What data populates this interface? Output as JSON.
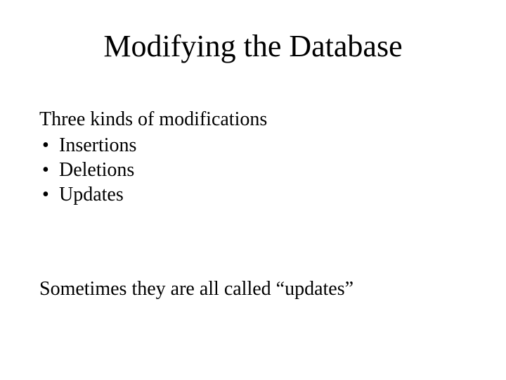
{
  "title": "Modifying the Database",
  "lead": "Three kinds of modifications",
  "bullets": [
    {
      "label": "Insertions"
    },
    {
      "label": "Deletions"
    },
    {
      "label": "Updates"
    }
  ],
  "footer": "Sometimes they are all called “updates”"
}
